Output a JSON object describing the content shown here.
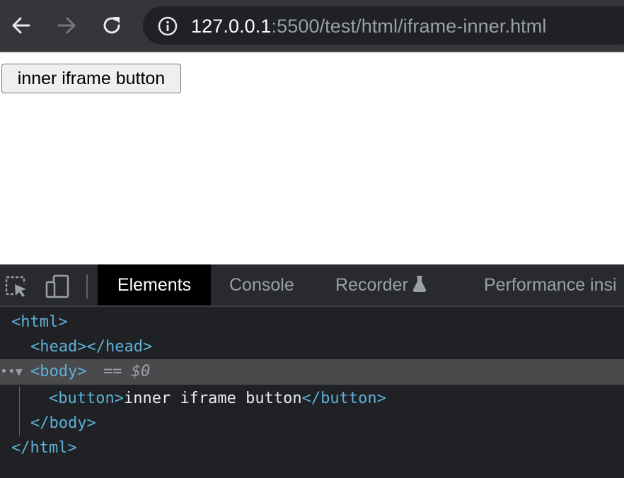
{
  "browser": {
    "url_host": "127.0.0.1",
    "url_rest": ":5500/test/html/iframe-inner.html",
    "back_icon": "arrow-left-icon",
    "forward_icon": "arrow-right-icon",
    "reload_icon": "reload-icon",
    "info_icon": "info-circle-icon"
  },
  "page": {
    "button_label": "inner iframe button"
  },
  "devtools": {
    "tabs": [
      {
        "label": "Elements",
        "active": true
      },
      {
        "label": "Console",
        "active": false
      },
      {
        "label": "Recorder",
        "active": false
      },
      {
        "label": "Performance insi",
        "active": false
      }
    ],
    "dom": {
      "html_open": "<html>",
      "head": "<head></head>",
      "body_open": "<body>",
      "selected_marker": "== $0",
      "button_open": "<button>",
      "button_text": "inner iframe button",
      "button_close": "</button>",
      "body_close": "</body>",
      "html_close": "</html>"
    }
  }
}
